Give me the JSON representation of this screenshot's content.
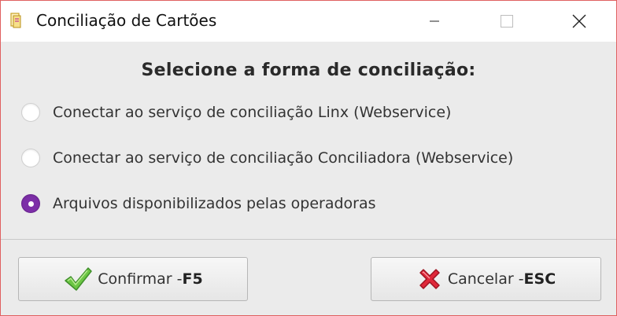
{
  "window": {
    "title": "Conciliação de Cartões",
    "controls": {
      "minimize": "minimize",
      "maximize": "maximize",
      "close": "close"
    }
  },
  "dialog": {
    "heading": "Selecione a forma de conciliação:",
    "options": [
      {
        "label": "Conectar ao serviço de conciliação Linx (Webservice)",
        "selected": false
      },
      {
        "label": "Conectar ao serviço de conciliação Conciliadora (Webservice)",
        "selected": false
      },
      {
        "label": "Arquivos disponibilizados pelas operadoras",
        "selected": true
      }
    ]
  },
  "buttons": {
    "confirm": {
      "label": "Confirmar - ",
      "shortcut": "F5",
      "icon": "checkmark-icon"
    },
    "cancel": {
      "label": "Cancelar - ",
      "shortcut": "ESC",
      "icon": "x-icon"
    }
  },
  "colors": {
    "accent": "#7d2fa8",
    "confirm_icon": "#5cbf3a",
    "cancel_icon": "#e0283a"
  }
}
